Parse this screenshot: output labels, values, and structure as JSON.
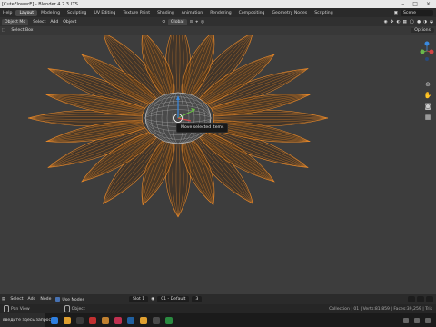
{
  "window": {
    "title": "[CuteFlowerE] - Blender 4.2.3 LTS",
    "controls": [
      "–",
      "□",
      "×"
    ]
  },
  "topbar": {
    "menu": [
      "Help"
    ],
    "workspaces": [
      "Layout",
      "Modeling",
      "Sculpting",
      "UV Editing",
      "Texture Paint",
      "Shading",
      "Animation",
      "Rendering",
      "Compositing",
      "Geometry Nodes",
      "Scripting"
    ],
    "active_workspace": "Layout",
    "scene": "Scene"
  },
  "header": {
    "mode": "Object Mo",
    "menu": [
      "Select",
      "Add",
      "Object"
    ],
    "orientation": "Global"
  },
  "toolrow": {
    "tool": "Select Box",
    "options": "Options"
  },
  "viewport": {
    "tooltip": "Move selected items",
    "wire_color": "#e8892a"
  },
  "timeline": {
    "menu": [
      "Select",
      "Add",
      "Node"
    ],
    "use_nodes": "Use Nodes",
    "slot": "Slot 1",
    "material": "01 - Default",
    "user_count": "3"
  },
  "statusbar": {
    "items": [
      {
        "label": "Pan View"
      },
      {
        "label": "Object"
      }
    ],
    "stats": "Collection | 01 | Verts:81,859 | Faces:39,259 | Tris"
  },
  "taskbar": {
    "search_placeholder": "введите здесь запрос",
    "app_colors": [
      "#2f7fe0",
      "#e0a030",
      "#3a3a3a",
      "#c23030",
      "#c08030",
      "#c03050",
      "#2060a0",
      "#e0a030",
      "#4a4a4a",
      "#2a8a40"
    ]
  }
}
